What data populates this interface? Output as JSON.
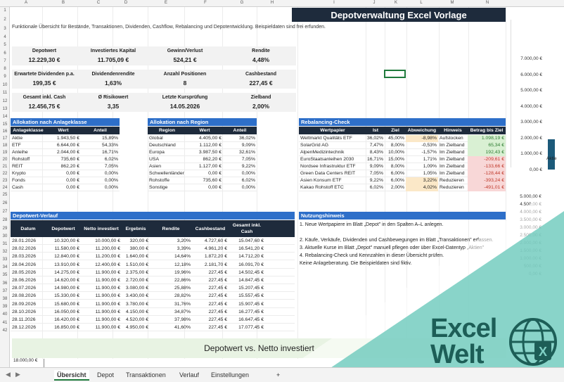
{
  "app": {
    "title": "Depotverwaltung Excel Vorlage",
    "subtitle": "Funktionale Übersicht für Bestände, Transaktionen, Dividenden, Cashflow, Rebalancing und Depotentwicklung. Beispieldaten sind frei erfunden."
  },
  "columns": [
    "A",
    "B",
    "C",
    "D",
    "E",
    "F",
    "G",
    "H",
    "I",
    "J",
    "K",
    "L",
    "M",
    "N"
  ],
  "rows": [
    "1",
    "2",
    "3",
    "4",
    "5",
    "6",
    "7",
    "8",
    "9",
    "10",
    "11",
    "12",
    "13",
    "14",
    "15",
    "16",
    "17",
    "18",
    "19",
    "20",
    "21",
    "22",
    "23",
    "24",
    "25",
    "26",
    "27",
    "28",
    "29",
    "30",
    "31",
    "32",
    "33",
    "34",
    "35",
    "36",
    "37",
    "38",
    "39",
    "40",
    "41",
    "42"
  ],
  "kpis": [
    {
      "label": "Depotwert",
      "value": "12.229,30 €"
    },
    {
      "label": "Investiertes Kapital",
      "value": "11.705,09 €"
    },
    {
      "label": "Gewinn/Verlust",
      "value": "524,21 €"
    },
    {
      "label": "Rendite",
      "value": "4,48%"
    },
    {
      "label": "Erwartete Dividenden p.a.",
      "value": "199,35 €"
    },
    {
      "label": "Dividendenrendite",
      "value": "1,63%"
    },
    {
      "label": "Anzahl Positionen",
      "value": "8"
    },
    {
      "label": "Cashbestand",
      "value": "227,45 €"
    },
    {
      "label": "Gesamt inkl. Cash",
      "value": "12.456,75 €"
    },
    {
      "label": "Ø Risikowert",
      "value": "3,35"
    },
    {
      "label": "Letzte Kursprüfung",
      "value": "14.05.2026"
    },
    {
      "label": "Zielband",
      "value": "2,00%"
    }
  ],
  "alloc_class": {
    "title": "Allokation nach Anlageklasse",
    "headers": [
      "Anlageklasse",
      "Wert",
      "Anteil"
    ],
    "rows": [
      [
        "Aktie",
        "1.943,50 €",
        "15,89%"
      ],
      [
        "ETF",
        "6.644,00 €",
        "54,33%"
      ],
      [
        "Anleihe",
        "2.044,00 €",
        "16,71%"
      ],
      [
        "Rohstoff",
        "735,60 €",
        "6,02%"
      ],
      [
        "REIT",
        "862,20 €",
        "7,05%"
      ],
      [
        "Krypto",
        "0,00 €",
        "0,00%"
      ],
      [
        "Fonds",
        "0,00 €",
        "0,00%"
      ],
      [
        "Cash",
        "0,00 €",
        "0,00%"
      ]
    ]
  },
  "alloc_region": {
    "title": "Allokation nach Region",
    "headers": [
      "Region",
      "Wert",
      "Anteil"
    ],
    "rows": [
      [
        "Global",
        "4.405,00 €",
        "36,02%"
      ],
      [
        "Deutschland",
        "1.112,00 €",
        "9,09%"
      ],
      [
        "Europa",
        "3.987,50 €",
        "32,61%"
      ],
      [
        "USA",
        "862,20 €",
        "7,05%"
      ],
      [
        "Asien",
        "1.127,00 €",
        "9,22%"
      ],
      [
        "Schwellenländer",
        "0,00 €",
        "0,00%"
      ],
      [
        "Rohstoffe",
        "735,60 €",
        "6,02%"
      ],
      [
        "Sonstige",
        "0,00 €",
        "0,00%"
      ]
    ]
  },
  "rebalancing": {
    "title": "Rebalancing-Check",
    "headers": [
      "Wertpapier",
      "Ist",
      "Ziel",
      "Abweichung",
      "Hinweis",
      "Betrag bis Ziel"
    ],
    "rows": [
      [
        "Weltmarkt Qualitäts ETF",
        "36,02%",
        "45,00%",
        "-8,98%",
        "Aufstocken",
        "1.098,19 €",
        "amber",
        "green"
      ],
      [
        "SolarGrid AG",
        "7,47%",
        "8,00%",
        "-0,53%",
        "Im Zielband",
        "65,34 €",
        "",
        "green"
      ],
      [
        "AlpenMedizintechnik",
        "8,43%",
        "10,00%",
        "-1,57%",
        "Im Zielband",
        "192,43 €",
        "",
        "green"
      ],
      [
        "EuroStaatsanleihen 2030",
        "16,71%",
        "15,00%",
        "1,71%",
        "Im Zielband",
        "-209,61 €",
        "",
        "red"
      ],
      [
        "Nordsee Infrastruktur ETF",
        "9,09%",
        "8,00%",
        "1,09%",
        "Im Zielband",
        "-133,66 €",
        "",
        "red"
      ],
      [
        "Green Data Centers REIT",
        "7,05%",
        "6,00%",
        "1,05%",
        "Im Zielband",
        "-128,44 €",
        "",
        "red"
      ],
      [
        "Asien Konsum ETF",
        "9,22%",
        "6,00%",
        "3,22%",
        "Reduzieren",
        "-393,24 €",
        "amber",
        "red"
      ],
      [
        "Kakao Rohstoff ETC",
        "6,02%",
        "2,00%",
        "4,02%",
        "Reduzieren",
        "-491,01 €",
        "amber",
        "red"
      ]
    ]
  },
  "verlauf": {
    "title": "Depotwert-Verlauf",
    "headers": [
      "Datum",
      "Depotwert",
      "Netto investiert",
      "Ergebnis",
      "Rendite",
      "Cashbestand",
      "Gesamt inkl. Cash"
    ],
    "rows": [
      [
        "28.01.2026",
        "10.320,00 €",
        "10.000,00 €",
        "320,00 €",
        "3,20%",
        "4.727,60 €",
        "15.047,60 €"
      ],
      [
        "28.02.2026",
        "11.580,00 €",
        "11.200,00 €",
        "380,00 €",
        "3,39%",
        "4.961,20 €",
        "16.541,20 €"
      ],
      [
        "28.03.2026",
        "12.840,00 €",
        "11.200,00 €",
        "1.640,00 €",
        "14,64%",
        "1.872,20 €",
        "14.712,20 €"
      ],
      [
        "28.04.2026",
        "13.910,00 €",
        "12.400,00 €",
        "1.510,00 €",
        "12,18%",
        "2.181,70 €",
        "16.091,70 €"
      ],
      [
        "28.05.2026",
        "14.275,00 €",
        "11.900,00 €",
        "2.375,00 €",
        "19,96%",
        "227,45 €",
        "14.502,45 €"
      ],
      [
        "28.06.2026",
        "14.620,00 €",
        "11.900,00 €",
        "2.720,00 €",
        "22,86%",
        "227,45 €",
        "14.847,45 €"
      ],
      [
        "28.07.2026",
        "14.980,00 €",
        "11.900,00 €",
        "3.080,00 €",
        "25,88%",
        "227,45 €",
        "15.207,45 €"
      ],
      [
        "28.08.2026",
        "15.330,00 €",
        "11.900,00 €",
        "3.430,00 €",
        "28,82%",
        "227,45 €",
        "15.557,45 €"
      ],
      [
        "28.09.2026",
        "15.680,00 €",
        "11.900,00 €",
        "3.780,00 €",
        "31,76%",
        "227,45 €",
        "15.907,45 €"
      ],
      [
        "28.10.2026",
        "16.050,00 €",
        "11.900,00 €",
        "4.150,00 €",
        "34,87%",
        "227,45 €",
        "16.277,45 €"
      ],
      [
        "28.11.2026",
        "16.420,00 €",
        "11.900,00 €",
        "4.520,00 €",
        "37,98%",
        "227,45 €",
        "16.647,45 €"
      ],
      [
        "28.12.2026",
        "16.850,00 €",
        "11.900,00 €",
        "4.950,00 €",
        "41,60%",
        "227,45 €",
        "17.077,45 €"
      ]
    ]
  },
  "hinweis": {
    "title": "Nutzungshinweis",
    "lines": [
      "1. Neue Wertpapiere im Blatt „Depot\" in den Spalten A–L anlegen.",
      "2. Käufe, Verkäufe, Dividenden und Cashbewegungen im Blatt „Transaktionen\" erfassen.",
      "3. Aktuelle Kurse im Blatt „Depot\" manuell pflegen oder über Excel-Datentyp „Aktien\"",
      "4. Rebalancing-Check und Kennzahlen in dieser Übersicht prüfen.",
      "Keine Anlageberatung. Die Beispieldaten sind fiktiv."
    ]
  },
  "chart_band": {
    "title": "Depotwert vs. Netto investiert",
    "y_tick": "18.000,00 €"
  },
  "side_chart": {
    "ticks": [
      "7.000,00 €",
      "6.000,00 €",
      "5.000,00 €",
      "4.000,00 €",
      "3.000,00 €",
      "2.000,00 €",
      "1.000,00 €",
      "0,00 €"
    ],
    "category": "Aktie",
    "bar_value": 1943.5,
    "ticks2": [
      "5.000,00 €",
      "4.500,00 €",
      "4.000,00 €",
      "3.500,00 €",
      "3.000,00 €",
      "2.500,00 €",
      "2.000,00 €",
      "1.500,00 €",
      "1.000,00 €",
      "500,00 €",
      "0,00 €"
    ]
  },
  "tabs": [
    "Übersicht",
    "Depot",
    "Transaktionen",
    "Verlauf",
    "Einstellungen"
  ],
  "add_tab": "+",
  "logo": {
    "line1": "Excel",
    "line2": "Welt"
  },
  "colors": {
    "navy": "#1e2b3c",
    "blue": "#2e6fc9",
    "teal": "#7fd0c4",
    "green": "#1f7a3c"
  }
}
